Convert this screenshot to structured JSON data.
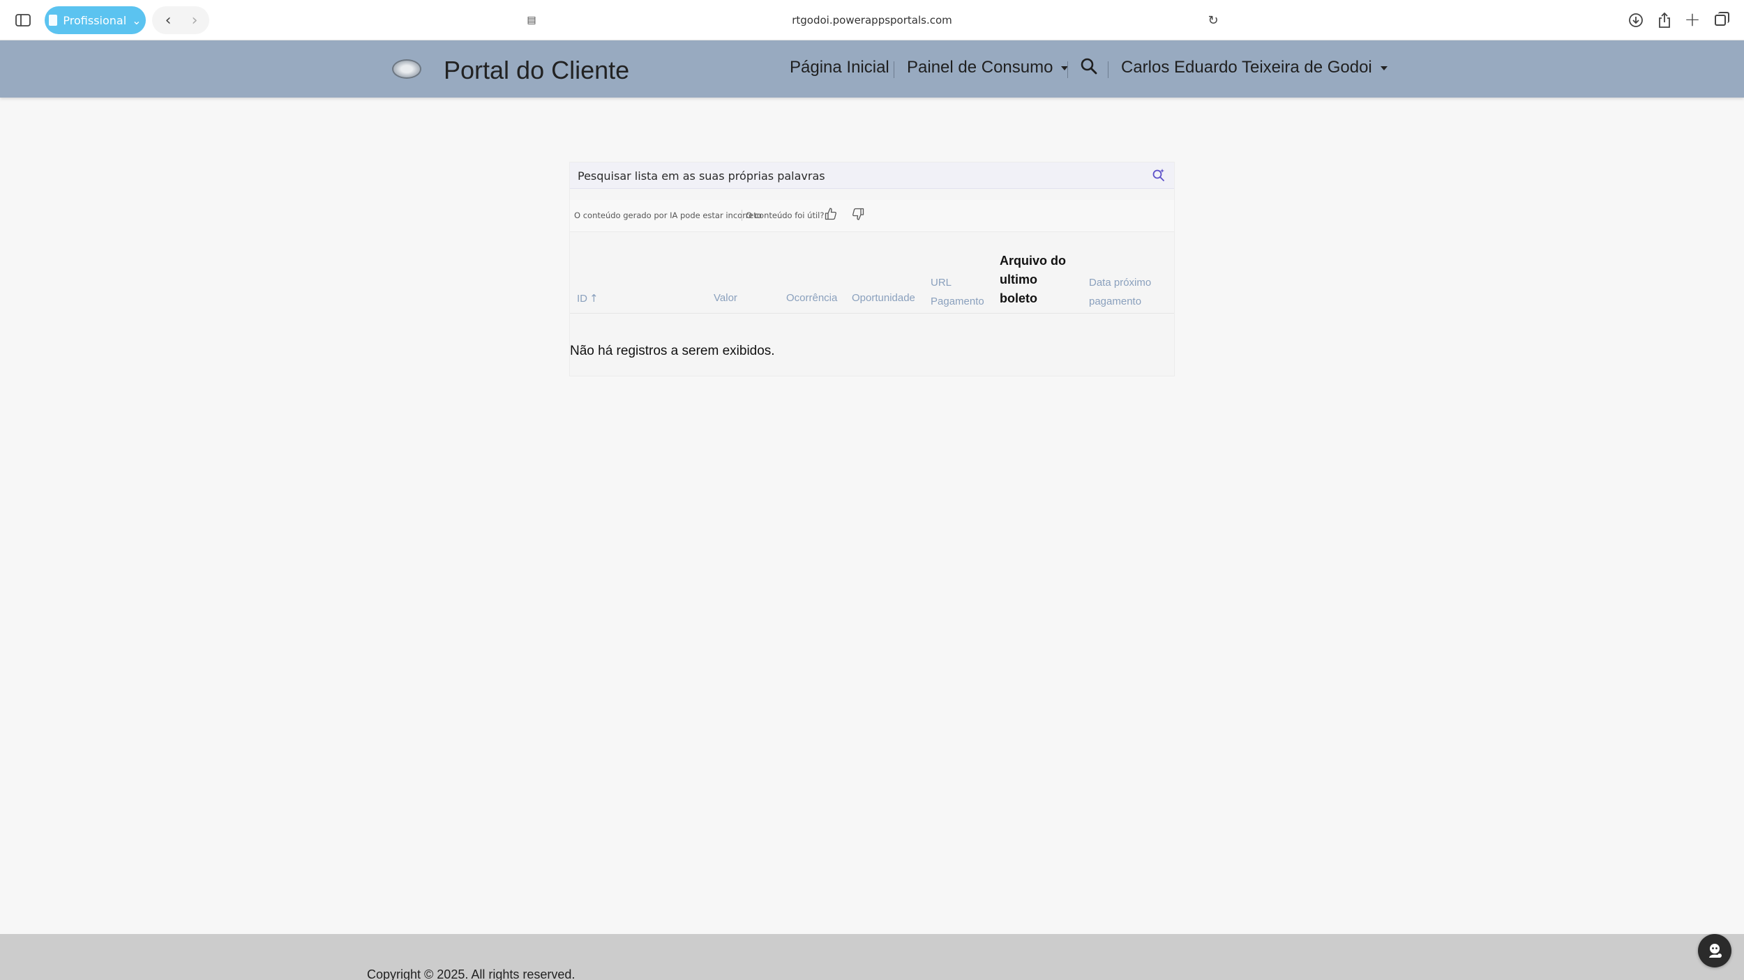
{
  "browser": {
    "profile_label": "Profissional",
    "url": "rtgodoi.powerappsportals.com",
    "icons": {
      "sidebar": "sidebar-icon",
      "back": "chevron-left-icon",
      "forward": "chevron-right-icon",
      "reload": "reload-icon",
      "download": "download-icon",
      "share": "share-icon",
      "new_tab": "plus-icon",
      "tabs": "tabs-overview-icon"
    }
  },
  "header": {
    "site_title": "Portal do Cliente",
    "nav": {
      "home": "Página Inicial",
      "consumo": "Painel de Consumo",
      "user": "Carlos Eduardo Teixeira de Godoi"
    },
    "background_color": "#98aac0"
  },
  "search": {
    "placeholder": "Pesquisar lista em as suas próprias palavras"
  },
  "ai_feedback": {
    "disclaimer": "O conteúdo gerado por IA pode estar incorreto",
    "question": "O conteúdo foi útil?"
  },
  "table": {
    "columns": [
      {
        "label": "ID",
        "sort": "ascending"
      },
      {
        "label": "Valor"
      },
      {
        "label": "Ocorrência"
      },
      {
        "label": "Oportunidade"
      },
      {
        "label": "URL Pagamento"
      },
      {
        "label": "Arquivo do ultimo boleto"
      },
      {
        "label": "Data próximo pagamento"
      }
    ],
    "empty_message": "Não há registros a serem exibidos."
  },
  "footer": {
    "copyright": "Copyright © 2025. All rights reserved."
  }
}
